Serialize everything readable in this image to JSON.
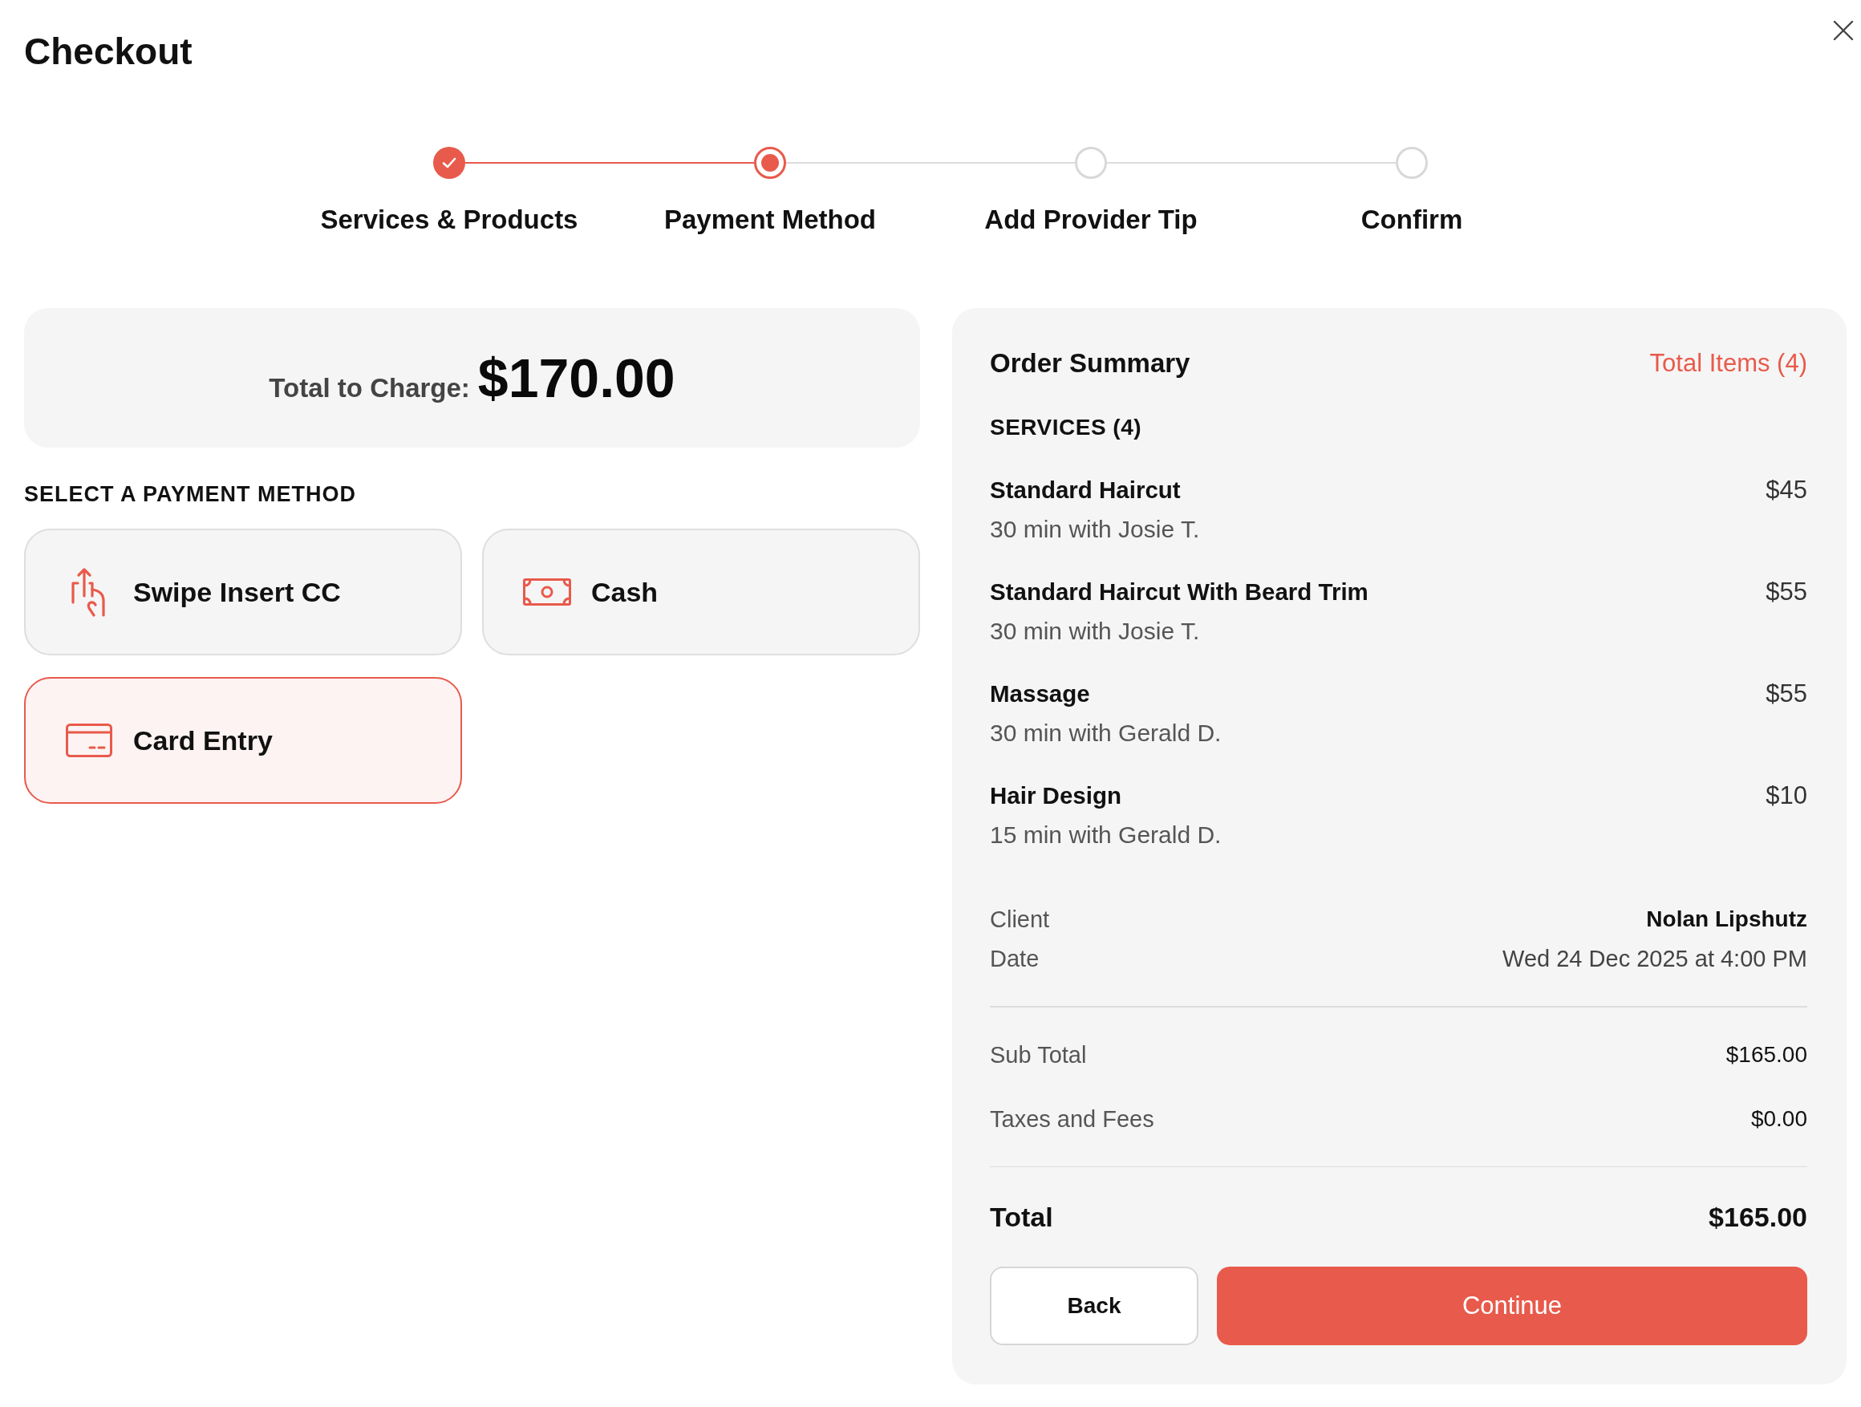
{
  "header": {
    "title": "Checkout"
  },
  "stepper": {
    "steps": [
      {
        "label": "Services & Products",
        "completed": true,
        "selected": false
      },
      {
        "label": "Payment Method",
        "completed": false,
        "selected": true
      },
      {
        "label": "Add Provider Tip",
        "completed": false,
        "selected": false
      },
      {
        "label": "Confirm",
        "completed": false,
        "selected": false
      }
    ]
  },
  "charge": {
    "label": "Total to Charge:",
    "amount": "$170.00"
  },
  "payment": {
    "heading": "SELECT A PAYMENT METHOD",
    "methods": [
      {
        "label": "Swipe Insert CC",
        "kind": "swipe",
        "selected": false
      },
      {
        "label": "Cash",
        "kind": "cash",
        "selected": false
      },
      {
        "label": "Card Entry",
        "kind": "card",
        "selected": true
      }
    ]
  },
  "order_summary": {
    "title": "Order Summary",
    "count": "Total Items (4)",
    "section": "SERVICES (4)",
    "services": [
      {
        "name": "Standard Haircut",
        "detail": "30 min with Josie T.",
        "price": "$45"
      },
      {
        "name": "Standard Haircut With Beard Trim",
        "detail": "30 min with Josie T.",
        "price": "$55"
      },
      {
        "name": "Massage",
        "detail": "30 min with Gerald D.",
        "price": "$55"
      },
      {
        "name": "Hair Design",
        "detail": "15 min with Gerald D.",
        "price": "$10"
      }
    ],
    "details": [
      {
        "label": "Client",
        "value": "Nolan Lipshutz",
        "kind": "strong"
      },
      {
        "label": "Date",
        "value": "Wed 24 Dec 2025 at 4:00 PM",
        "kind": "plain"
      }
    ],
    "totals": [
      {
        "label": "Sub Total",
        "value": "$165.00"
      },
      {
        "label": "Taxes and Fees",
        "value": "$0.00"
      }
    ],
    "total": {
      "label": "Total",
      "value": "$165.00"
    },
    "buttons": [
      {
        "label": "Back",
        "kind": "back"
      },
      {
        "label": "Continue",
        "kind": "continue"
      }
    ]
  }
}
